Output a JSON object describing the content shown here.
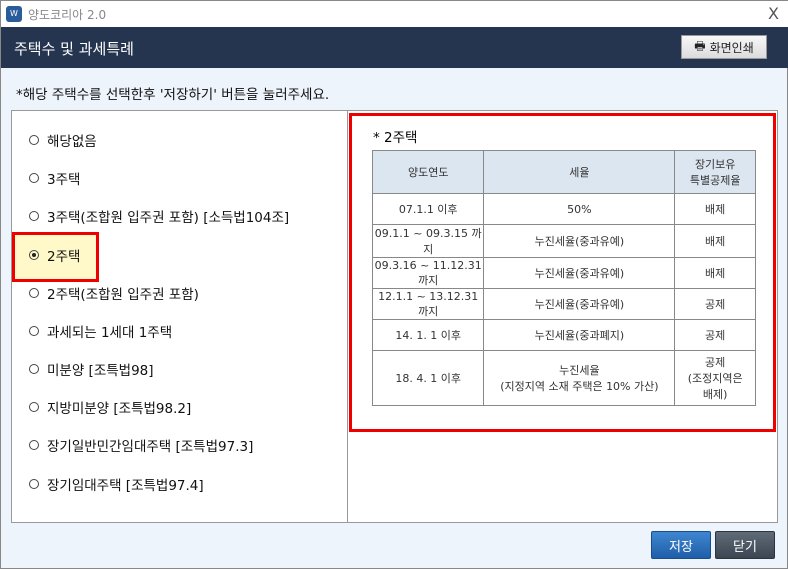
{
  "window": {
    "title": "양도코리아 2.0",
    "close": "X"
  },
  "header": {
    "title": "주택수 및 과세특례",
    "print_label": "화면인쇄"
  },
  "instruction": "*해당 주택수를 선택한후 '저장하기' 버튼을 눌러주세요.",
  "options": [
    {
      "label": "해당없음",
      "selected": false
    },
    {
      "label": "3주택",
      "selected": false
    },
    {
      "label": "3주택(조합원 입주권 포함) [소득법104조]",
      "selected": false
    },
    {
      "label": "2주택",
      "selected": true
    },
    {
      "label": "2주택(조합원 입주권 포함)",
      "selected": false
    },
    {
      "label": "과세되는 1세대 1주택",
      "selected": false
    },
    {
      "label": "미분양 [조특법98]",
      "selected": false
    },
    {
      "label": "지방미분양 [조특법98.2]",
      "selected": false
    },
    {
      "label": "장기일반민간임대주택 [조특법97.3]",
      "selected": false
    },
    {
      "label": "장기임대주택 [조특법97.4]",
      "selected": false
    }
  ],
  "detail": {
    "title": "* 2주택",
    "headers": [
      "양도연도",
      "세율",
      "장기보유\n특별공제율"
    ],
    "rows": [
      [
        "07.1.1 이후",
        "50%",
        "배제"
      ],
      [
        "09.1.1 ~ 09.3.15 까지",
        "누진세율(중과유예)",
        "배제"
      ],
      [
        "09.3.16 ~ 11.12.31까지",
        "누진세율(중과유예)",
        "배제"
      ],
      [
        "12.1.1 ~ 13.12.31 까지",
        "누진세율(중과유예)",
        "공제"
      ],
      [
        "14. 1. 1 이후",
        "누진세율(중과폐지)",
        "공제"
      ],
      [
        "18. 4. 1 이후",
        "누진세율\n(지정지역 소재 주택은 10% 가산)",
        "공제\n(조정지역은\n배제)"
      ]
    ]
  },
  "buttons": {
    "save": "저장",
    "close": "닫기"
  }
}
